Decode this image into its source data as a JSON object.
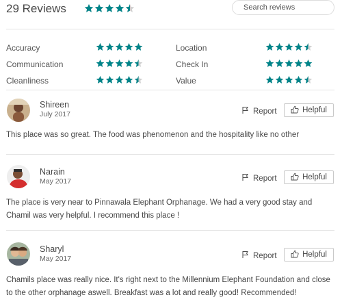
{
  "header": {
    "review_count": "29 Reviews",
    "overall_rating": 4.5,
    "search_placeholder": "Search reviews"
  },
  "colors": {
    "star": "#008489",
    "text": "#484848",
    "border": "#dcdcdc"
  },
  "ratings": [
    {
      "label": "Accuracy",
      "value": 5
    },
    {
      "label": "Communication",
      "value": 4.5
    },
    {
      "label": "Cleanliness",
      "value": 4.5
    },
    {
      "label": "Location",
      "value": 4.5
    },
    {
      "label": "Check In",
      "value": 5
    },
    {
      "label": "Value",
      "value": 4.5
    }
  ],
  "reviews": [
    {
      "name": "Shireen",
      "date": "July 2017",
      "avatar_icon": "user-photo-icon",
      "text": "This place was so great. The food was phenomenon and the hospitality like no other",
      "report_label": "Report",
      "helpful_label": "Helpful"
    },
    {
      "name": "Narain",
      "date": "May 2017",
      "avatar_icon": "user-photo-icon",
      "text": "The place is very near to Pinnawala Elephant Orphanage. We had a very good stay and Chamil was very helpful. I recommend this place !",
      "report_label": "Report",
      "helpful_label": "Helpful"
    },
    {
      "name": "Sharyl",
      "date": "May 2017",
      "avatar_icon": "user-photo-icon",
      "text": "Chamils place was really nice. It's right next to the Millennium Elephant Foundation and close to the other orphanage aswell. Breakfast was a lot and really good! Recommended!",
      "report_label": "Report",
      "helpful_label": "Helpful"
    }
  ]
}
